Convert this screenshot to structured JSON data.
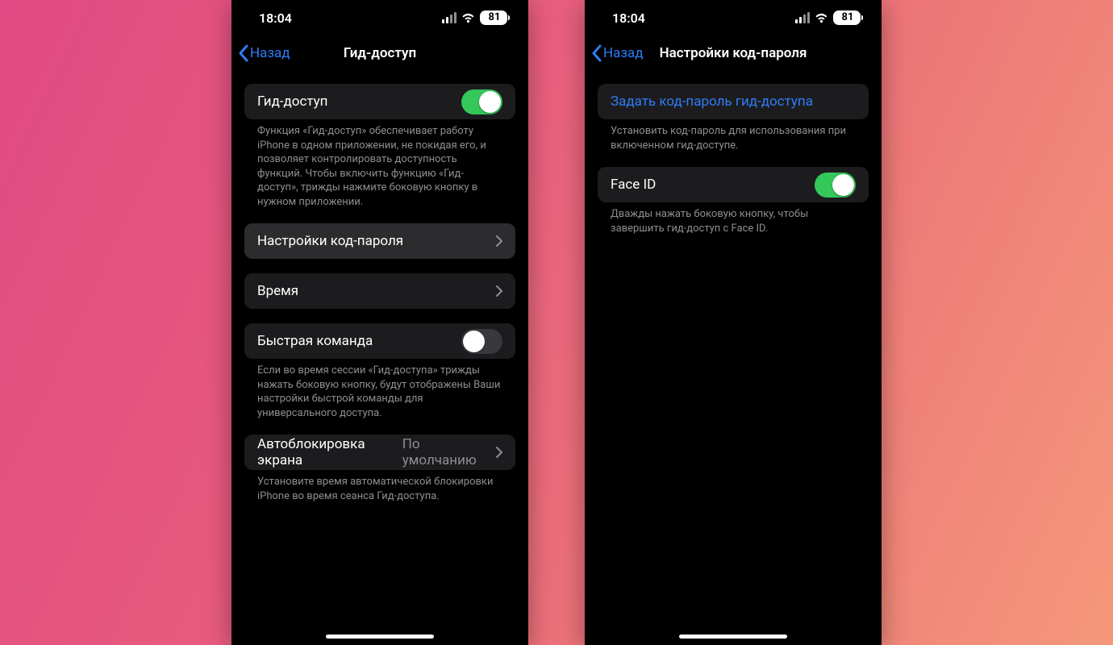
{
  "status": {
    "time": "18:04",
    "battery": "81"
  },
  "nav": {
    "back": "Назад"
  },
  "left": {
    "title": "Гид-доступ",
    "toggle": {
      "label": "Гид-доступ",
      "footer": "Функция «Гид-доступ» обеспечивает работу iPhone в одном приложении, не покидая его, и позволяет контролировать доступность функций. Чтобы включить функцию «Гид-доступ», трижды нажмите боковую кнопку в нужном приложении."
    },
    "passcode_row": "Настройки код-пароля",
    "time_row": "Время",
    "shortcut": {
      "label": "Быстрая команда",
      "footer": "Если во время сессии «Гид-доступа» трижды нажать боковую кнопку, будут отображены Ваши настройки быстрой команды для универсального доступа."
    },
    "autolock": {
      "label": "Автоблокировка экрана",
      "value": "По умолчанию",
      "footer": "Установите время автоматической блокировки iPhone во время сеанса Гид-доступа."
    }
  },
  "right": {
    "title": "Настройки код-пароля",
    "set_passcode": {
      "label": "Задать код-пароль гид-доступа",
      "footer": "Установить код-пароль для использования при включенном гид-доступе."
    },
    "faceid": {
      "label": "Face ID",
      "footer": "Дважды нажать боковую кнопку, чтобы завершить гид-доступ с Face ID."
    }
  }
}
